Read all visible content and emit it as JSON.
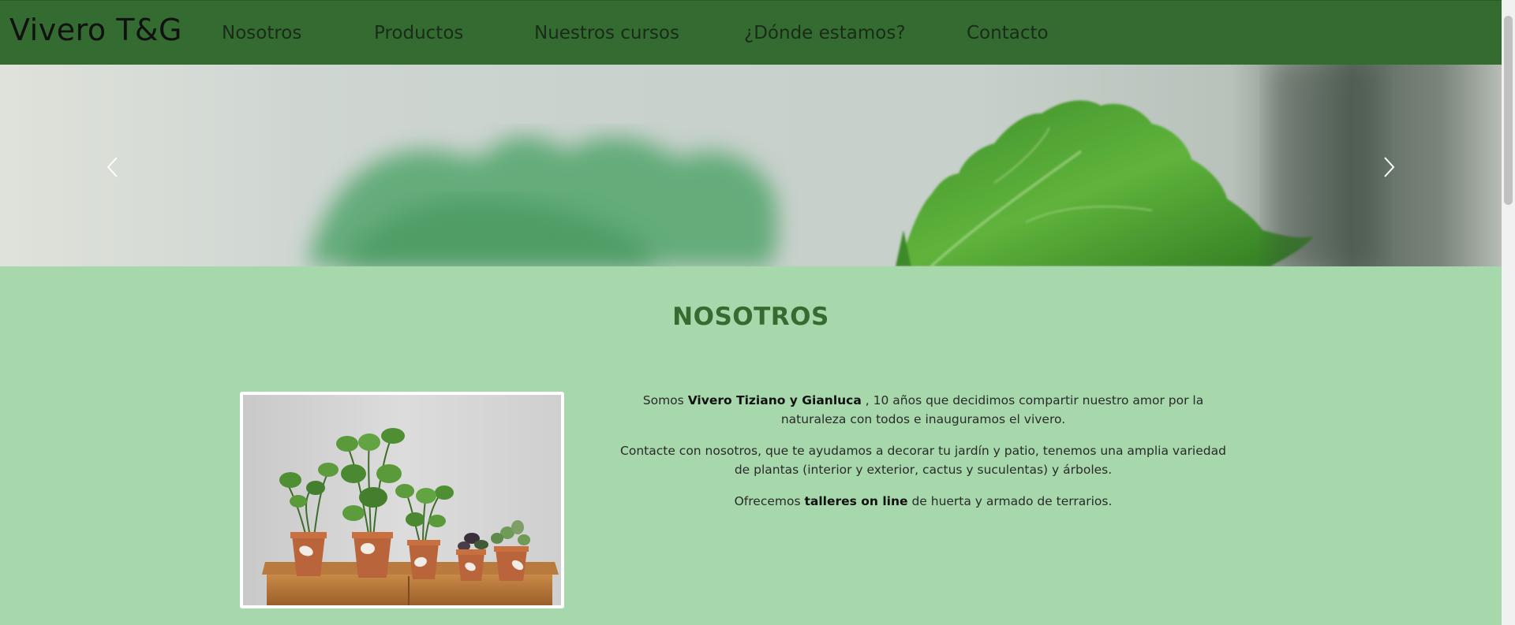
{
  "navbar": {
    "brand": "Vivero T&G",
    "links": [
      "Nosotros",
      "Productos",
      "Nuestros cursos",
      "¿Dónde estamos?",
      "Contacto"
    ],
    "background": "#336b30"
  },
  "carousel": {
    "prev_icon": "chevron-left-icon",
    "next_icon": "chevron-right-icon"
  },
  "about": {
    "title": "NOSOTROS",
    "title_color": "#336b30",
    "background": "#a7d8ac",
    "p1": {
      "before": "Somos ",
      "bold": "Vivero Tiziano y Gianluca",
      "after": " , 10 años que decidimos compartir nuestro amor por la naturaleza con todos e inauguramos el vivero."
    },
    "p2": "Contacte con nosotros, que te ayudamos a decorar tu jardín y patio, tenemos una amplia variedad de plantas (interior y exterior, cactus y suculentas) y árboles.",
    "p3": {
      "before": "Ofrecemos ",
      "bold": "talleres on line",
      "after": " de huerta y armado de terrarios."
    }
  }
}
